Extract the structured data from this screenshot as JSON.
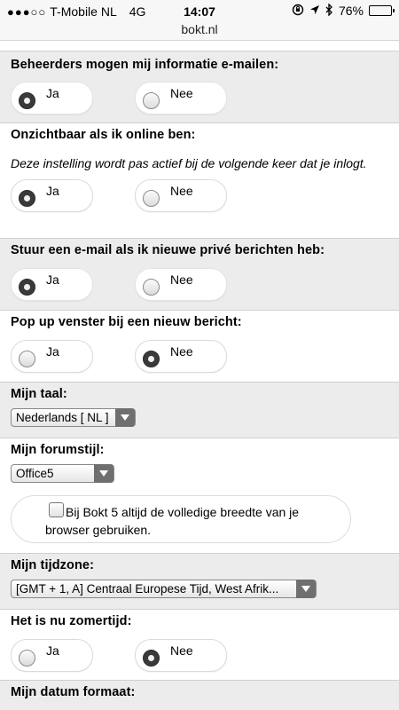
{
  "status_bar": {
    "signal": "●●●○○",
    "carrier": "T-Mobile NL",
    "network": "4G",
    "time": "14:07",
    "url": "bokt.nl",
    "battery_percent": "76%",
    "battery_level": 0.76,
    "icons": [
      "orientation-lock-icon",
      "location-icon",
      "bluetooth-icon",
      "battery-icon"
    ]
  },
  "settings": {
    "admin_email": {
      "title": "Beheerders mogen mij informatie e-mailen:",
      "options": [
        {
          "label": "Ja",
          "checked": true
        },
        {
          "label": "Nee",
          "checked": false
        }
      ]
    },
    "invisible": {
      "title": "Onzichtbaar als ik online ben:",
      "note": "Deze instelling wordt pas actief bij de volgende keer dat je inlogt.",
      "options": [
        {
          "label": "Ja",
          "checked": true
        },
        {
          "label": "Nee",
          "checked": false
        }
      ]
    },
    "pm_email": {
      "title": "Stuur een e-mail als ik nieuwe privé berichten heb:",
      "options": [
        {
          "label": "Ja",
          "checked": true
        },
        {
          "label": "Nee",
          "checked": false
        }
      ]
    },
    "popup": {
      "title": "Pop up venster bij een nieuw bericht:",
      "options": [
        {
          "label": "Ja",
          "checked": false
        },
        {
          "label": "Nee",
          "checked": true
        }
      ]
    },
    "language": {
      "title": "Mijn taal:",
      "selected": "Nederlands [ NL ]"
    },
    "forum_style": {
      "title": "Mijn forumstijl:",
      "selected": "Office5",
      "checkbox_label": "Bij Bokt 5 altijd de volledige breedte van je browser gebruiken.",
      "checkbox_checked": false
    },
    "timezone": {
      "title": "Mijn tijdzone:",
      "selected": "[GMT + 1, A] Centraal Europese Tijd, West Afrik..."
    },
    "dst": {
      "title": "Het is nu zomertijd:",
      "options": [
        {
          "label": "Ja",
          "checked": false
        },
        {
          "label": "Nee",
          "checked": true
        }
      ]
    },
    "date_format": {
      "title": "Mijn datum formaat:"
    }
  }
}
